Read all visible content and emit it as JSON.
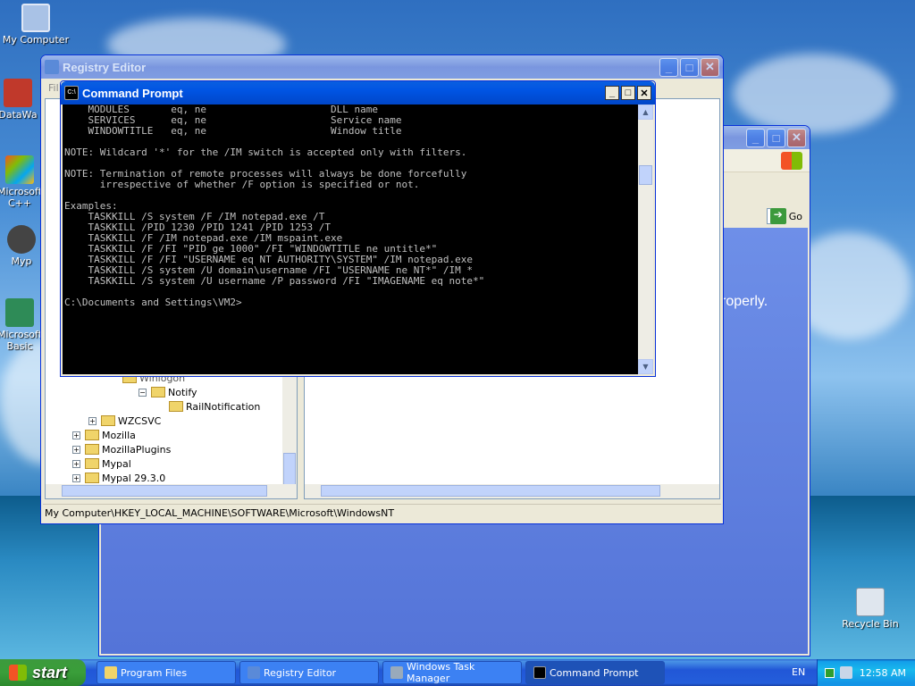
{
  "desktop": {
    "icons": [
      {
        "label": "My Computer"
      },
      {
        "label": "DataWa"
      },
      {
        "label": "Microsoft C++"
      },
      {
        "label": "Myp"
      },
      {
        "label": "Microsoft Basic"
      },
      {
        "label": "Recycle Bin"
      }
    ]
  },
  "back_window": {
    "go_label": "Go",
    "text_fragment": "roperly."
  },
  "registry_editor": {
    "title": "Registry Editor",
    "menu_fragment": "Fil",
    "tree": [
      {
        "label": "Winlogon",
        "expander": ""
      },
      {
        "label": "Notify",
        "expander": "−"
      },
      {
        "label": "RailNotification",
        "expander": ""
      },
      {
        "label": "WZCSVC",
        "expander": "+"
      },
      {
        "label": "Mozilla",
        "expander": "+"
      },
      {
        "label": "MozillaPlugins",
        "expander": "+"
      },
      {
        "label": "Mypal",
        "expander": "+"
      },
      {
        "label": "Mypal 29.3.0",
        "expander": "+"
      }
    ],
    "status_path": "My Computer\\HKEY_LOCAL_MACHINE\\SOFTWARE\\Microsoft\\WindowsNT"
  },
  "command_prompt": {
    "title": "Command Prompt",
    "lines": [
      "    MODULES       eq, ne                     DLL name",
      "    SERVICES      eq, ne                     Service name",
      "    WINDOWTITLE   eq, ne                     Window title",
      "",
      "NOTE: Wildcard '*' for the /IM switch is accepted only with filters.",
      "",
      "NOTE: Termination of remote processes will always be done forcefully",
      "      irrespective of whether /F option is specified or not.",
      "",
      "Examples:",
      "    TASKKILL /S system /F /IM notepad.exe /T",
      "    TASKKILL /PID 1230 /PID 1241 /PID 1253 /T",
      "    TASKKILL /F /IM notepad.exe /IM mspaint.exe",
      "    TASKKILL /F /FI \"PID ge 1000\" /FI \"WINDOWTITLE ne untitle*\"",
      "    TASKKILL /F /FI \"USERNAME eq NT AUTHORITY\\SYSTEM\" /IM notepad.exe",
      "    TASKKILL /S system /U domain\\username /FI \"USERNAME ne NT*\" /IM *",
      "    TASKKILL /S system /U username /P password /FI \"IMAGENAME eq note*\"",
      "",
      "C:\\Documents and Settings\\VM2>"
    ]
  },
  "taskbar": {
    "start_label": "start",
    "tasks": [
      {
        "label": "Program Files"
      },
      {
        "label": "Registry Editor"
      },
      {
        "label": "Windows Task Manager"
      },
      {
        "label": "Command Prompt"
      }
    ],
    "language": "EN",
    "clock": "12:58 AM"
  }
}
